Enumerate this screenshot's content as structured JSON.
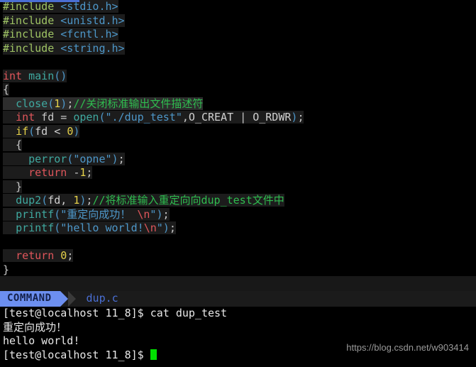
{
  "window": {
    "app": "vim",
    "filename": "dup.c"
  },
  "editor": {
    "lines": [
      {
        "tokens": [
          {
            "c": "t-pre",
            "t": "#include"
          },
          {
            "c": "t-punct",
            "t": " "
          },
          {
            "c": "t-inc",
            "t": "<stdio.h>"
          }
        ]
      },
      {
        "tokens": [
          {
            "c": "t-pre",
            "t": "#include"
          },
          {
            "c": "t-punct",
            "t": " "
          },
          {
            "c": "t-inc",
            "t": "<unistd.h>"
          }
        ]
      },
      {
        "tokens": [
          {
            "c": "t-pre",
            "t": "#include"
          },
          {
            "c": "t-punct",
            "t": " "
          },
          {
            "c": "t-inc",
            "t": "<fcntl.h>"
          }
        ]
      },
      {
        "tokens": [
          {
            "c": "t-pre",
            "t": "#include"
          },
          {
            "c": "t-punct",
            "t": " "
          },
          {
            "c": "t-inc",
            "t": "<string.h>"
          }
        ]
      },
      {
        "tokens": [
          {
            "c": "t-punct",
            "t": ""
          }
        ]
      },
      {
        "tokens": [
          {
            "c": "t-type",
            "t": "int"
          },
          {
            "c": "t-punct",
            "t": " "
          },
          {
            "c": "t-func",
            "t": "main"
          },
          {
            "c": "t-paren",
            "t": "()"
          }
        ]
      },
      {
        "tokens": [
          {
            "c": "t-punct",
            "t": "{"
          }
        ]
      },
      {
        "cursorline": true,
        "tokens": [
          {
            "c": "t-punct",
            "t": "  "
          },
          {
            "c": "t-func",
            "t": "close"
          },
          {
            "c": "t-paren",
            "t": "("
          },
          {
            "c": "t-num",
            "t": "1"
          },
          {
            "c": "t-paren",
            "t": ")"
          },
          {
            "c": "t-punct",
            "t": ";"
          },
          {
            "c": "t-comment",
            "t": "//关闭标准输出文件描述符"
          }
        ]
      },
      {
        "tokens": [
          {
            "c": "t-punct",
            "t": "  "
          },
          {
            "c": "t-type",
            "t": "int"
          },
          {
            "c": "t-punct",
            "t": " fd = "
          },
          {
            "c": "t-func",
            "t": "open"
          },
          {
            "c": "t-paren",
            "t": "("
          },
          {
            "c": "t-str",
            "t": "\"./dup_test\""
          },
          {
            "c": "t-punct",
            "t": ","
          },
          {
            "c": "t-const",
            "t": "O_CREAT"
          },
          {
            "c": "t-punct",
            "t": " | "
          },
          {
            "c": "t-const",
            "t": "O_RDWR"
          },
          {
            "c": "t-paren",
            "t": ")"
          },
          {
            "c": "t-punct",
            "t": ";"
          }
        ]
      },
      {
        "tokens": [
          {
            "c": "t-punct",
            "t": "  "
          },
          {
            "c": "t-kw",
            "t": "if"
          },
          {
            "c": "t-paren",
            "t": "("
          },
          {
            "c": "t-ident",
            "t": "fd < "
          },
          {
            "c": "t-num",
            "t": "0"
          },
          {
            "c": "t-paren",
            "t": ")"
          }
        ]
      },
      {
        "tokens": [
          {
            "c": "t-punct",
            "t": "  {"
          }
        ]
      },
      {
        "tokens": [
          {
            "c": "t-punct",
            "t": "    "
          },
          {
            "c": "t-func",
            "t": "perror"
          },
          {
            "c": "t-paren",
            "t": "("
          },
          {
            "c": "t-str",
            "t": "\"opne\""
          },
          {
            "c": "t-paren",
            "t": ")"
          },
          {
            "c": "t-punct",
            "t": ";"
          }
        ]
      },
      {
        "tokens": [
          {
            "c": "t-punct",
            "t": "    "
          },
          {
            "c": "t-type",
            "t": "return"
          },
          {
            "c": "t-punct",
            "t": " -"
          },
          {
            "c": "t-num",
            "t": "1"
          },
          {
            "c": "t-punct",
            "t": ";"
          }
        ]
      },
      {
        "tokens": [
          {
            "c": "t-punct",
            "t": "  }"
          }
        ]
      },
      {
        "tokens": [
          {
            "c": "t-punct",
            "t": "  "
          },
          {
            "c": "t-func",
            "t": "dup2"
          },
          {
            "c": "t-paren",
            "t": "("
          },
          {
            "c": "t-ident",
            "t": "fd, "
          },
          {
            "c": "t-num",
            "t": "1"
          },
          {
            "c": "t-paren",
            "t": ")"
          },
          {
            "c": "t-punct",
            "t": ";"
          },
          {
            "c": "t-comment",
            "t": "//将标准输入重定向向dup_test文件中"
          }
        ]
      },
      {
        "tokens": [
          {
            "c": "t-punct",
            "t": "  "
          },
          {
            "c": "t-func",
            "t": "printf"
          },
          {
            "c": "t-paren",
            "t": "("
          },
          {
            "c": "t-str",
            "t": "\"重定向成功！ "
          },
          {
            "c": "t-esc",
            "t": "\\n"
          },
          {
            "c": "t-str",
            "t": "\""
          },
          {
            "c": "t-paren",
            "t": ")"
          },
          {
            "c": "t-punct",
            "t": ";"
          }
        ]
      },
      {
        "tokens": [
          {
            "c": "t-punct",
            "t": "  "
          },
          {
            "c": "t-func",
            "t": "printf"
          },
          {
            "c": "t-paren",
            "t": "("
          },
          {
            "c": "t-str",
            "t": "\"hello world!"
          },
          {
            "c": "t-esc",
            "t": "\\n"
          },
          {
            "c": "t-str",
            "t": "\""
          },
          {
            "c": "t-paren",
            "t": ")"
          },
          {
            "c": "t-punct",
            "t": ";"
          }
        ]
      },
      {
        "tokens": [
          {
            "c": "t-punct",
            "t": ""
          }
        ]
      },
      {
        "tokens": [
          {
            "c": "t-punct",
            "t": "  "
          },
          {
            "c": "t-type",
            "t": "return"
          },
          {
            "c": "t-punct",
            "t": " "
          },
          {
            "c": "t-num",
            "t": "0"
          },
          {
            "c": "t-punct",
            "t": ";"
          }
        ]
      },
      {
        "nobg": true,
        "tokens": [
          {
            "c": "t-punct",
            "t": "}"
          }
        ]
      }
    ],
    "filler_rows": [
      "~"
    ]
  },
  "statusline": {
    "mode": "COMMAND",
    "filename": "dup.c"
  },
  "shell": {
    "lines": [
      "[test@localhost 11_8]$ cat dup_test",
      "重定向成功！",
      "hello world!"
    ],
    "prompt": "[test@localhost 11_8]$ "
  },
  "watermark": {
    "text": "https://blog.csdn.net/w903414"
  },
  "colors": {
    "editor_bg": "#000000",
    "screen_bg": "#181818",
    "text_run_bg": "#1c1c1c",
    "cursorline_bg": "#2d2d2d",
    "mode_badge_bg": "#6c8ff0",
    "mode_badge_fg": "#13204a",
    "filename_fg": "#4a6fd4",
    "cursor_green": "#00e000",
    "comment_green": "#2fbd4f",
    "preproc_green": "#9fc464",
    "include_blue": "#4d97c9",
    "keyword_red": "#e0565b",
    "func_teal": "#3fa9a0",
    "number_yellow": "#e6d24a",
    "shell_fg": "#e8e8e8",
    "watermark_fg": "#9a9a9a"
  }
}
